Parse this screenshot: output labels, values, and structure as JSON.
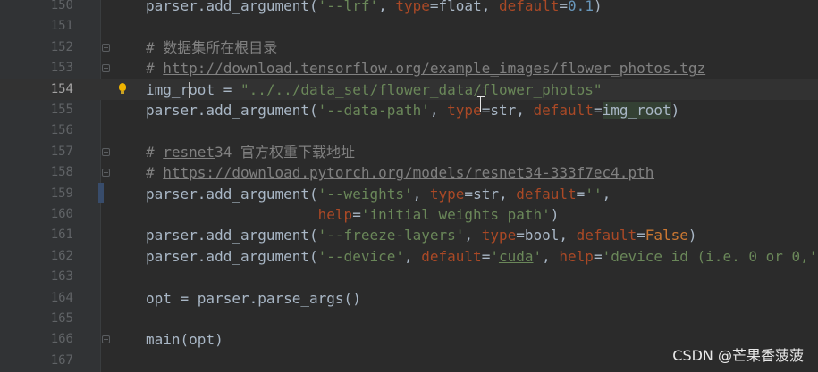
{
  "editor": {
    "lines": [
      {
        "num": "150"
      },
      {
        "num": "151"
      },
      {
        "num": "152"
      },
      {
        "num": "153"
      },
      {
        "num": "154"
      },
      {
        "num": "155"
      },
      {
        "num": "156"
      },
      {
        "num": "157"
      },
      {
        "num": "158"
      },
      {
        "num": "159"
      },
      {
        "num": "160"
      },
      {
        "num": "161"
      },
      {
        "num": "162"
      },
      {
        "num": "163"
      },
      {
        "num": "164"
      },
      {
        "num": "165"
      },
      {
        "num": "166"
      },
      {
        "num": "167"
      }
    ],
    "tokens": {
      "l150": [
        "parser.add_argument(",
        "'--lrf'",
        ", ",
        "type",
        "=",
        "float",
        ", ",
        "default",
        "=",
        "0.1",
        ")"
      ],
      "l152": "# 数据集所在根目录",
      "l153_prefix": "# ",
      "l153_url": "http://download.tensorflow.org/example_images/flower_photos.tgz",
      "l154": [
        "img_r",
        "oot",
        " = ",
        "\"../../data_set/flower_data/flower_photos\""
      ],
      "l155": [
        "parser.add_argument(",
        "'--data-path'",
        ", ",
        "type",
        "=",
        "str",
        ", ",
        "default",
        "=",
        "img_root",
        ")"
      ],
      "l157_prefix": "# ",
      "l157_word": "resnet",
      "l157_rest": "34 官方权重下载地址",
      "l158_prefix": "# ",
      "l158_url": "https://download.pytorch.org/models/resnet34-333f7ec4.pth",
      "l159": [
        "parser.add_argument(",
        "'--weights'",
        ", ",
        "type",
        "=",
        "str",
        ", ",
        "default",
        "=",
        "''",
        ","
      ],
      "l160": [
        "                    ",
        "help",
        "=",
        "'initial weights path'",
        ")"
      ],
      "l161": [
        "parser.add_argument(",
        "'--freeze-layers'",
        ", ",
        "type",
        "=",
        "bool",
        ", ",
        "default",
        "=",
        "False",
        ")"
      ],
      "l162": [
        "parser.add_argument(",
        "'--device'",
        ", ",
        "default",
        "=",
        "'",
        "cuda",
        "'",
        ", ",
        "help",
        "=",
        "'device id (i.e. 0 or 0,'"
      ],
      "l164": "opt = parser.parse_args()",
      "l166": "main(opt)"
    }
  },
  "watermark": "CSDN @芒果香菠菠",
  "colors": {
    "background": "#2b2b2b",
    "gutter": "#313335",
    "keyword": "#cc7832",
    "kwarg": "#aa4926",
    "string": "#6a8759",
    "number": "#6897bb",
    "comment": "#808080",
    "text": "#a9b7c6"
  },
  "icons": {
    "intention": "lightbulb-icon",
    "fold": "fold-marker-icon",
    "cursor": "text-cursor-icon"
  }
}
